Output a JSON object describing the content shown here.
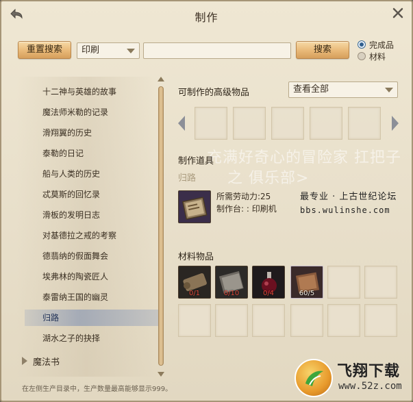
{
  "window": {
    "title": "制作"
  },
  "toolbar": {
    "reset_label": "重置搜索",
    "category_value": "印刷",
    "search_value": "",
    "search_label": "搜索",
    "radio_options": [
      {
        "label": "完成品",
        "selected": true
      },
      {
        "label": "材料",
        "selected": false
      }
    ]
  },
  "recipe_list": {
    "items": [
      "十二神与英雄的故事",
      "魔法师米勒的记录",
      "滑翔翼的历史",
      "泰勒的日记",
      "船与人类的历史",
      "忒莫斯的回忆录",
      "滑板的发明日志",
      "对基德拉之戒的考察",
      "德翡纳的假面舞会",
      "埃弗林的陶瓷匠人",
      "泰雷纳王国的幽灵",
      "归路",
      "湖水之子的抉择"
    ],
    "selected_index": 11,
    "category": "魔法书"
  },
  "advanced": {
    "header": "可制作的高级物品",
    "view_value": "查看全部"
  },
  "tool": {
    "header": "制作道具",
    "recipe_name": "归路",
    "labor_text": "所需劳动力:25",
    "bench_text": "制作台: : 印刷机"
  },
  "materials": {
    "header": "材料物品",
    "items": [
      {
        "name": "scroll-material",
        "count": "0/1",
        "enough": false
      },
      {
        "name": "paper-material",
        "count": "0/10",
        "enough": false
      },
      {
        "name": "ink-potion-material",
        "count": "0/4",
        "enough": false
      },
      {
        "name": "book-material",
        "count": "60/5",
        "enough": true
      }
    ]
  },
  "footer": {
    "note": "在左侧生产目录中，生产数量最高能够显示999。"
  },
  "watermark": {
    "line1": "充满好奇心的冒险家 扛把子",
    "line2": "之 俱乐部>",
    "site_name": "最专业 · 上古世纪论坛",
    "site_url": "bbs.wulinshe.com"
  },
  "logo": {
    "name": "飞翔下载",
    "url": "www.52z.com"
  },
  "colors": {
    "accent_gold": "#e8b877",
    "selected_row": "#7a8cb4",
    "count_short": "#e04a3a"
  }
}
